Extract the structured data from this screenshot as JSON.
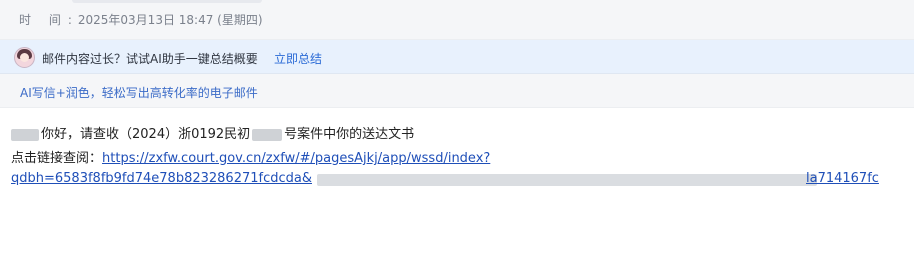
{
  "header": {
    "time_label": "时 间",
    "time_value": "2025年03月13日 18:47 (星期四)"
  },
  "ai_bar": {
    "message": "邮件内容过长？试试AI助手一键总结概要",
    "action": "立即总结"
  },
  "ai_write": {
    "link": "AI写信+润色，轻松写出高转化率的电子邮件"
  },
  "email_body": {
    "greeting_part1": "你好，请查收（2024）浙0192民初",
    "greeting_part2": "号案件中你的送达文书",
    "link_label": "点击链接查阅：",
    "link_line1": "https://zxfw.court.gov.cn/zxfw/#/pagesAjkj/app/wssd/index?",
    "link_line2_start": "qdbh=6583f8fb9fd74e78b823286271fcdcda&",
    "link_line2_end": "la714167fc"
  }
}
